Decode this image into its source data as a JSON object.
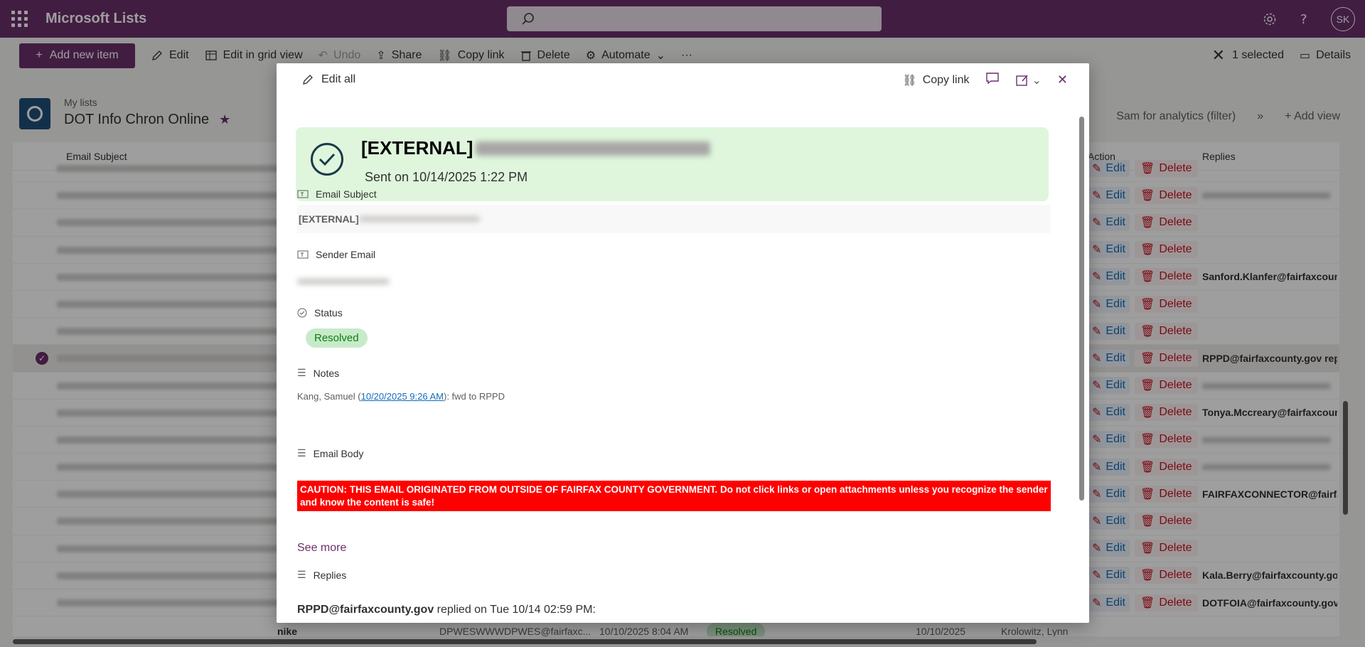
{
  "app": {
    "name": "Microsoft Lists",
    "avatar_initials": "SK"
  },
  "command_bar": {
    "add_new_item": "Add new item",
    "edit": "Edit",
    "edit_grid": "Edit in grid view",
    "undo": "Undo",
    "share": "Share",
    "copy_link": "Copy link",
    "delete": "Delete",
    "automate": "Automate",
    "more": "···",
    "selected_count": "1 selected",
    "details": "Details"
  },
  "list": {
    "breadcrumb": "My lists",
    "title": "DOT Info Chron Online",
    "views": [
      "Sam for analytics (filter)",
      "»",
      "Add view"
    ]
  },
  "grid": {
    "columns": {
      "email_subject": "Email Subject",
      "action": "Action",
      "replies": "Replies"
    },
    "row_edit_label": "Edit",
    "row_delete_label": "Delete",
    "rows": [
      {
        "reply": ""
      },
      {
        "reply": "",
        "blur": true
      },
      {
        "reply": ""
      },
      {
        "reply": ""
      },
      {
        "reply": "Sanford.Klanfer@fairfaxcount"
      },
      {
        "reply": ""
      },
      {
        "reply": ""
      },
      {
        "reply": "RPPD@fairfaxcounty.gov repli",
        "selected": true
      },
      {
        "reply": "",
        "blur": true
      },
      {
        "reply": "Tonya.Mccreary@fairfaxcount"
      },
      {
        "reply": "",
        "blur": true
      },
      {
        "reply": "",
        "blur": true
      },
      {
        "reply": "FAIRFAXCONNECTOR@fairfaxc"
      },
      {
        "reply": ""
      },
      {
        "reply": ""
      },
      {
        "reply": "Kala.Berry@fairfaxcounty.gov"
      },
      {
        "reply": "DOTFOIA@fairfaxcounty.gov re"
      }
    ],
    "bottom_row": {
      "subject_suffix": "nike",
      "sender": "DPWESWWWDPWES@fairfaxc...",
      "date1": "10/10/2025 8:04 AM",
      "status": "Resolved",
      "date2": "10/10/2025",
      "person": "Krolowitz, Lynn"
    }
  },
  "dialog": {
    "edit_all": "Edit all",
    "copy_link": "Copy link",
    "banner_title_prefix": "[EXTERNAL]",
    "banner_sent": "Sent on 10/14/2025 1:22 PM",
    "fields": {
      "email_subject_label": "Email Subject",
      "email_subject_value": "[EXTERNAL]",
      "sender_email_label": "Sender Email",
      "status_label": "Status",
      "status_value": "Resolved",
      "notes_label": "Notes",
      "notes_author": "Kang, Samuel (",
      "notes_link": "10/20/2025 9:26 AM",
      "notes_text": "): fwd to RPPD",
      "email_body_label": "Email Body",
      "caution": "CAUTION: THIS EMAIL ORIGINATED FROM OUTSIDE OF FAIRFAX COUNTY GOVERNMENT. Do not click links or open attachments unless you recognize the sender and know the content is safe!",
      "see_more": "See more",
      "replies_label": "Replies",
      "reply_sender": "RPPD@fairfaxcounty.gov",
      "reply_text": " replied on Tue 10/14 02:59 PM:"
    }
  },
  "colors": {
    "brand": "#6b2f6b",
    "resolved_bg": "#c7ebc9",
    "banner_bg": "#dff6dd",
    "caution_bg": "#ff0000"
  }
}
